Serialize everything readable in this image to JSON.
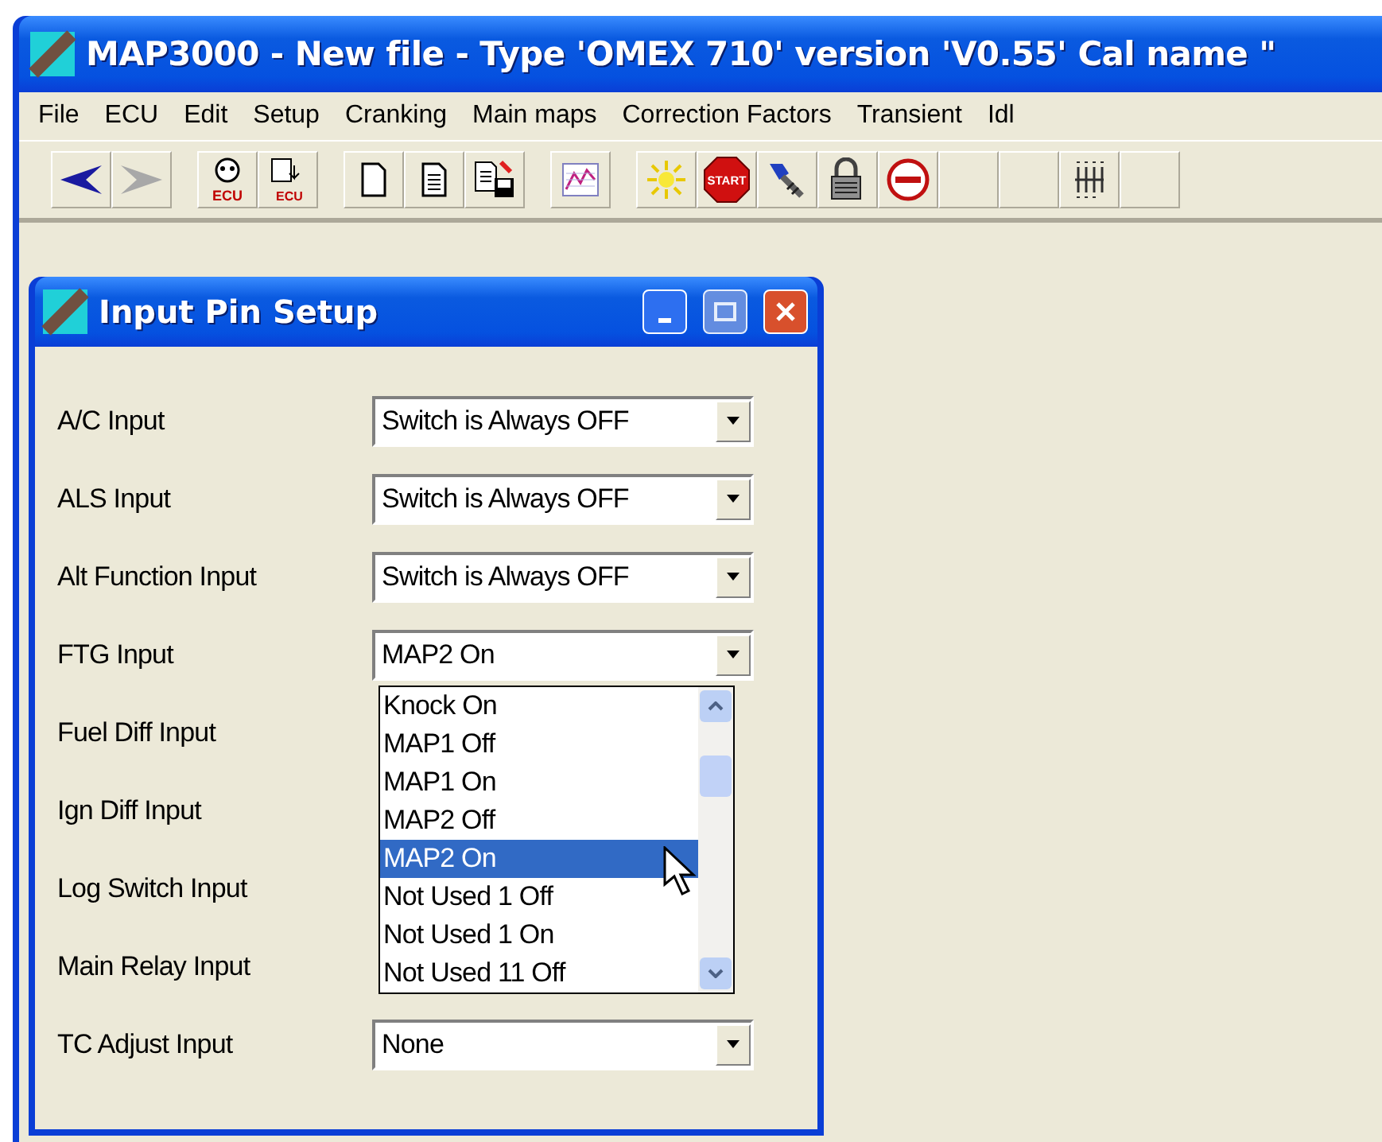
{
  "window": {
    "title": "MAP3000 - New file - Type 'OMEX 710' version 'V0.55' Cal name \""
  },
  "menu": [
    "File",
    "ECU",
    "Edit",
    "Setup",
    "Cranking",
    "Main maps",
    "Correction Factors",
    "Transient",
    "Idl"
  ],
  "toolbar": [
    {
      "kind": "back"
    },
    {
      "kind": "forward",
      "disabled": true
    },
    {
      "kind": "gap"
    },
    {
      "kind": "ecu-read",
      "label": "ECU"
    },
    {
      "kind": "ecu-write",
      "label": "ECU"
    },
    {
      "kind": "gap"
    },
    {
      "kind": "new"
    },
    {
      "kind": "open"
    },
    {
      "kind": "save"
    },
    {
      "kind": "gap"
    },
    {
      "kind": "chart"
    },
    {
      "kind": "gap"
    },
    {
      "kind": "sun"
    },
    {
      "kind": "start",
      "label": "START"
    },
    {
      "kind": "injector"
    },
    {
      "kind": "lock"
    },
    {
      "kind": "noentry"
    },
    {
      "kind": "blank"
    },
    {
      "kind": "blank"
    },
    {
      "kind": "grid"
    },
    {
      "kind": "blank"
    }
  ],
  "dialog": {
    "title": "Input Pin Setup",
    "rows": [
      {
        "label": "A/C Input",
        "value": "Switch is Always OFF"
      },
      {
        "label": "ALS Input",
        "value": "Switch is Always OFF"
      },
      {
        "label": "Alt Function Input",
        "value": "Switch is Always OFF"
      },
      {
        "label": "FTG Input",
        "value": "MAP2 On",
        "options": [
          {
            "text": "Knock On",
            "selected": false
          },
          {
            "text": "MAP1 Off",
            "selected": false
          },
          {
            "text": "MAP1 On",
            "selected": false
          },
          {
            "text": "MAP2 Off",
            "selected": false
          },
          {
            "text": "MAP2 On",
            "selected": true
          },
          {
            "text": "Not Used 1 Off",
            "selected": false
          },
          {
            "text": "Not Used 1 On",
            "selected": false
          },
          {
            "text": "Not Used 11 Off",
            "selected": false
          }
        ]
      },
      {
        "label": "Fuel Diff Input"
      },
      {
        "label": "Ign Diff Input"
      },
      {
        "label": "Log Switch Input"
      },
      {
        "label": "Main Relay Input"
      },
      {
        "label": "TC Adjust Input",
        "value": "None"
      }
    ]
  }
}
